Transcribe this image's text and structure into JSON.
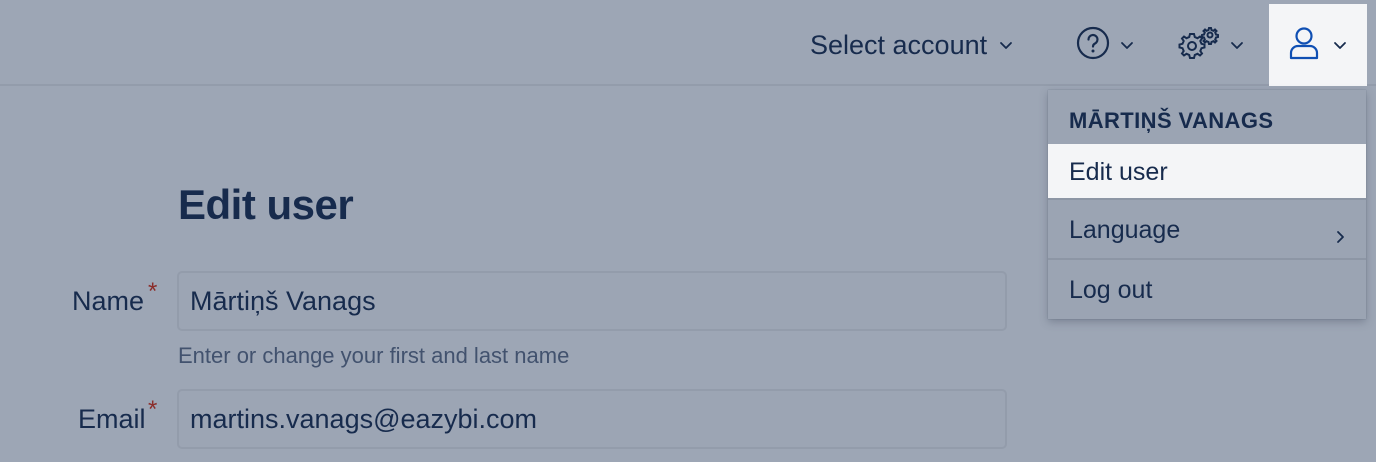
{
  "header": {
    "select_account_label": "Select account",
    "icons": [
      "help-icon",
      "settings-icon",
      "user-icon",
      "chevron-down-icon"
    ]
  },
  "user_menu": {
    "user_name": "MĀRTIŅŠ VANAGS",
    "items": [
      {
        "label": "Edit user",
        "active": true
      },
      {
        "label": "Language",
        "has_submenu": true
      },
      {
        "label": "Log out"
      }
    ]
  },
  "form": {
    "title": "Edit user",
    "name_label": "Name",
    "name_value": "Mārtiņš Vanags",
    "name_hint": "Enter or change your first and last name",
    "email_label": "Email",
    "email_value": "martins.vanags@eazybi.com",
    "required_marker": "*"
  },
  "colors": {
    "overlay_background": "#9da6b5",
    "text": "#172b4d",
    "required": "#8b2d2a",
    "active_item": "#f4f5f7"
  }
}
